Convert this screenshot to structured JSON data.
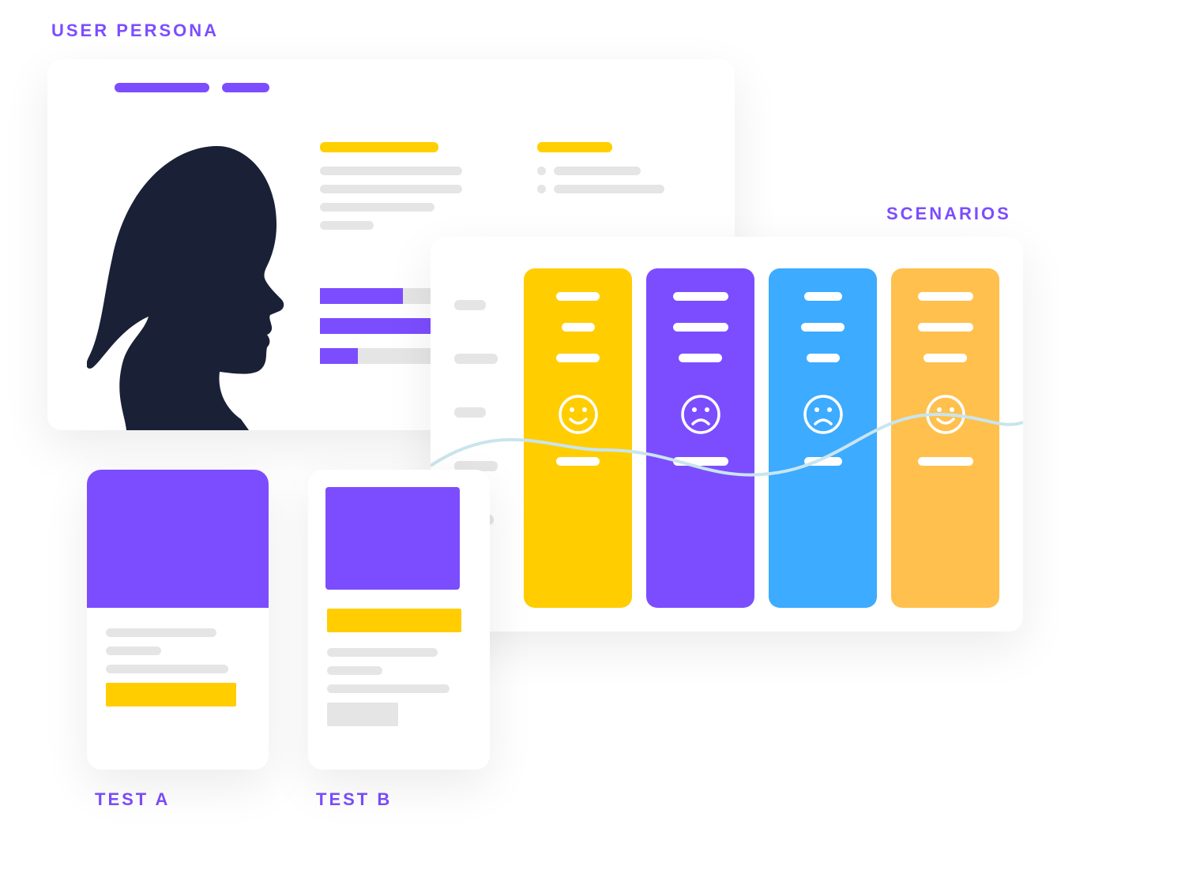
{
  "labels": {
    "user_persona": "USER PERSONA",
    "scenarios": "SCENARIOS",
    "test_a": "TEST A",
    "test_b": "TEST B"
  },
  "colors": {
    "purple": "#7c4dff",
    "yellow": "#ffcd00",
    "blue": "#3dabff",
    "orange": "#ffc04d",
    "dark": "#1a2036",
    "grey": "#e5e5e5",
    "line": "#c9e5ee"
  },
  "persona": {
    "progress": [
      55,
      80,
      25
    ]
  },
  "scenarios": {
    "columns": [
      {
        "color": "yellow",
        "mood": "happy"
      },
      {
        "color": "purple",
        "mood": "sad"
      },
      {
        "color": "blue",
        "mood": "sad"
      },
      {
        "color": "orange",
        "mood": "happy"
      }
    ]
  },
  "tests": {
    "a": {
      "variant": "full_image",
      "cta_color": "yellow"
    },
    "b": {
      "variant": "inset_image",
      "cta_color": "yellow"
    }
  }
}
